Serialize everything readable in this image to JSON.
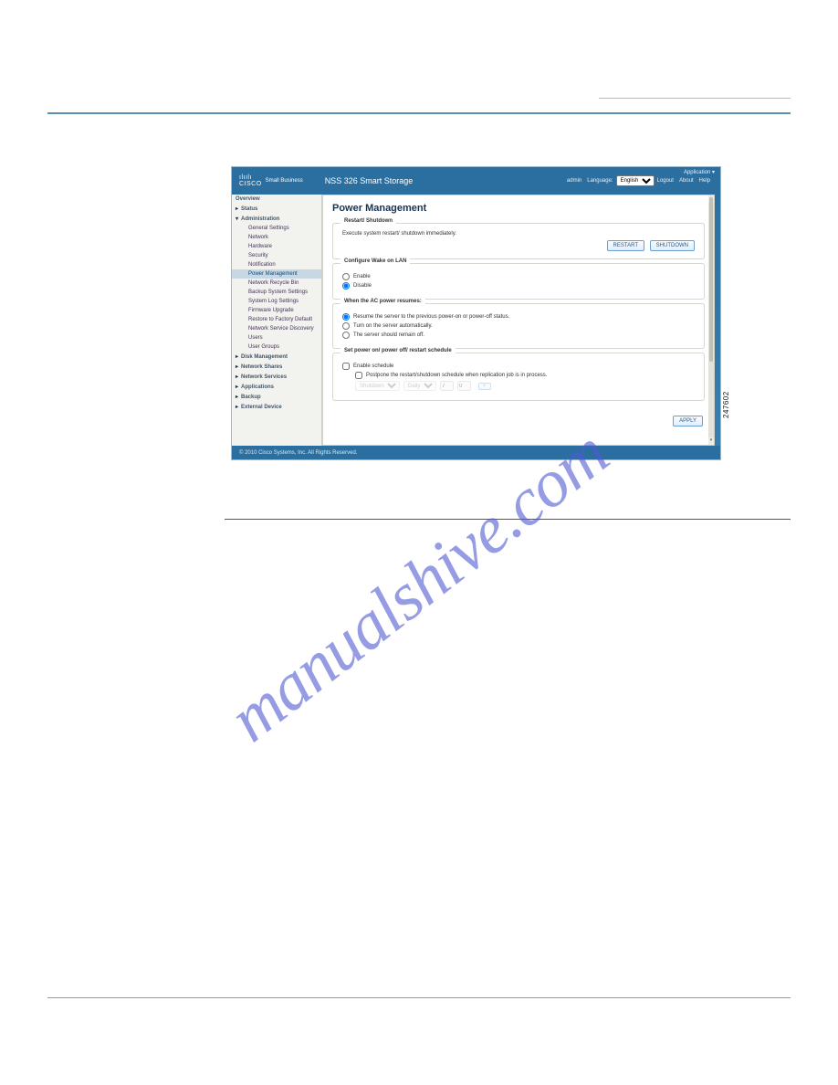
{
  "header": {
    "brand_small": "Small Business",
    "product": "NSS 326 Smart Storage",
    "user": "admin",
    "language_label": "Language:",
    "language_value": "English",
    "logout": "Logout",
    "about": "About",
    "help": "Help",
    "application": "Application ▾"
  },
  "sidebar": {
    "overview": "Overview",
    "status": "Status",
    "administration": "Administration",
    "subs": {
      "general": "General Settings",
      "network": "Network",
      "hardware": "Hardware",
      "security": "Security",
      "notification": "Notification",
      "power": "Power Management",
      "recycle": "Network Recycle Bin",
      "backup_sys": "Backup System Settings",
      "syslog": "System Log Settings",
      "firmware": "Firmware Upgrade",
      "restore": "Restore to Factory Default",
      "discover": "Network Service Discovery",
      "users": "Users",
      "groups": "User Groups"
    },
    "diskmgmt": "Disk Management",
    "netshares": "Network Shares",
    "netsvc": "Network Services",
    "apps": "Applications",
    "backup": "Backup",
    "extdev": "External Device"
  },
  "main": {
    "title": "Power Management",
    "restart": {
      "legend": "Restart/ Shutdown",
      "text": "Execute system restart/ shutdown immediately.",
      "btn_restart": "RESTART",
      "btn_shutdown": "SHUTDOWN"
    },
    "wol": {
      "legend": "Configure Wake on LAN",
      "enable": "Enable",
      "disable": "Disable"
    },
    "ac": {
      "legend": "When the AC power resumes:",
      "opt1": "Resume the server to the previous power-on or power-off status.",
      "opt2": "Turn on the server automatically.",
      "opt3": "The server should remain off."
    },
    "sched": {
      "legend": "Set power on/ power off/ restart schedule",
      "enable": "Enable schedule",
      "postpone": "Postpone the restart/shutdown schedule when replication job is in process.",
      "action_val": "Shutdown",
      "freq_val": "Daily",
      "h": "7",
      "m": "0"
    },
    "apply": "APPLY"
  },
  "footer": {
    "copyright": "© 2010 Cisco Systems, Inc. All Rights Reserved."
  },
  "image_id": "247602",
  "watermark": "manualshive.com"
}
